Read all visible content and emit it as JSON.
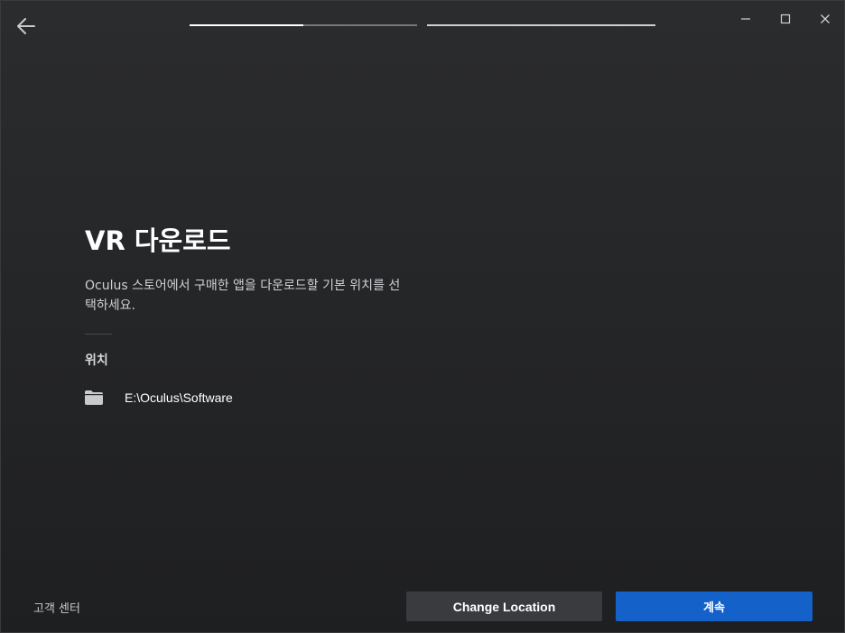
{
  "header": {
    "back_icon": "arrow-left-icon",
    "steps": [
      {
        "fill_fraction": 0.5
      },
      {
        "fill_fraction": 0.0
      }
    ]
  },
  "window_controls": {
    "minimize_icon": "minimize-icon",
    "maximize_icon": "maximize-icon",
    "close_icon": "close-icon"
  },
  "main": {
    "title": "VR 다운로드",
    "description": "Oculus 스토어에서 구매한 앱을 다운로드할 기본 위치를 선택하세요.",
    "section_label": "위치",
    "location": {
      "icon": "folder-icon",
      "path": "E:\\Oculus\\Software"
    }
  },
  "footer": {
    "support_link": "고객 센터",
    "change_location_label": "Change Location",
    "continue_label": "계속"
  },
  "colors": {
    "primary_button": "#1461c9",
    "secondary_button": "#3a3b3e",
    "background_top": "#2b2c2e",
    "background_bottom": "#1e1f21"
  }
}
